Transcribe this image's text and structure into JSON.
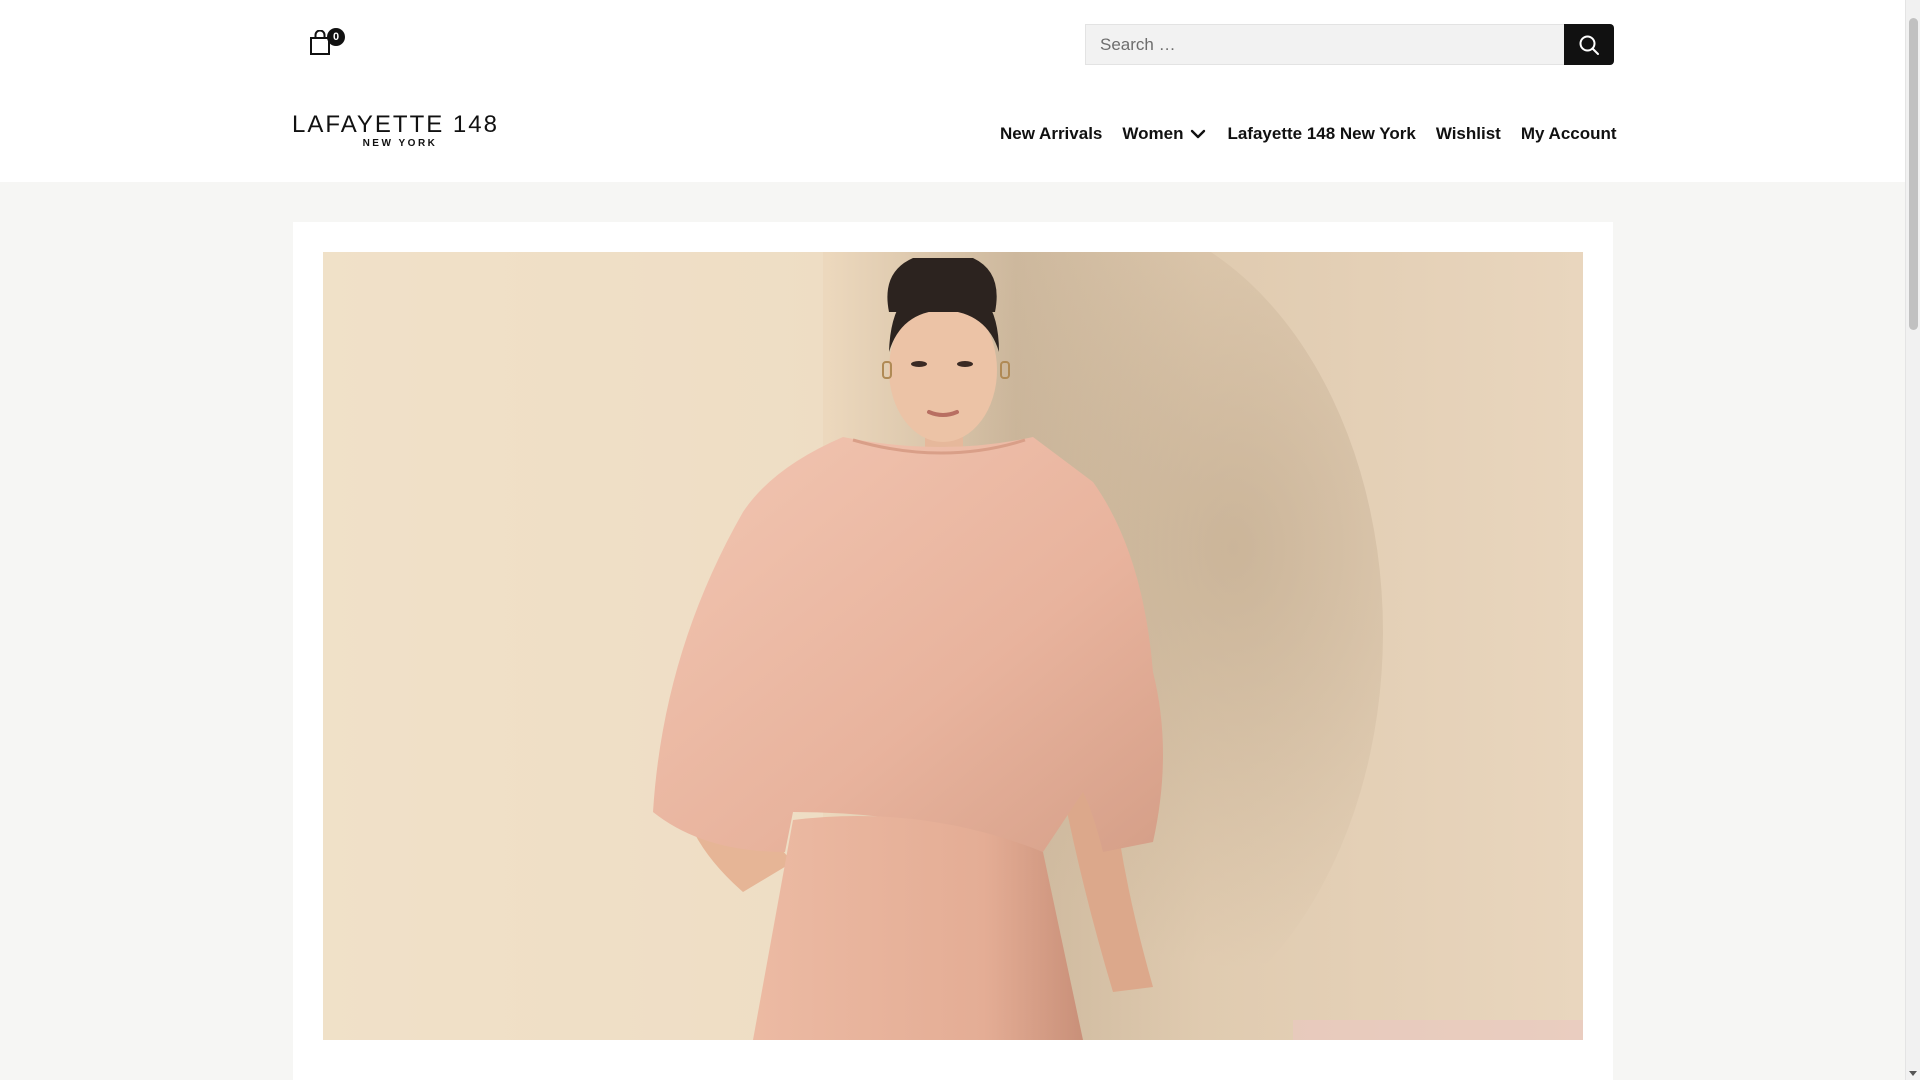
{
  "header": {
    "cart": {
      "count": "0",
      "icon": "shopping-bag-icon"
    },
    "search": {
      "placeholder": "Search …",
      "value": "",
      "button_icon": "search-icon"
    },
    "logo": {
      "main": "LAFAYETTE 148",
      "sub": "NEW YORK"
    },
    "nav": [
      {
        "label": "New Arrivals"
      },
      {
        "label": "Women",
        "icon": "chevron-down-icon"
      },
      {
        "label": "Lafayette 148 New York"
      },
      {
        "label": "Wishlist"
      },
      {
        "label": "My Account"
      }
    ]
  },
  "hero": {
    "image": "model-in-blush-knit-top-and-skirt-photo"
  },
  "colors": {
    "accent": "#111111",
    "page_background": "#f6f6f4",
    "search_background": "#f2f2f2"
  }
}
